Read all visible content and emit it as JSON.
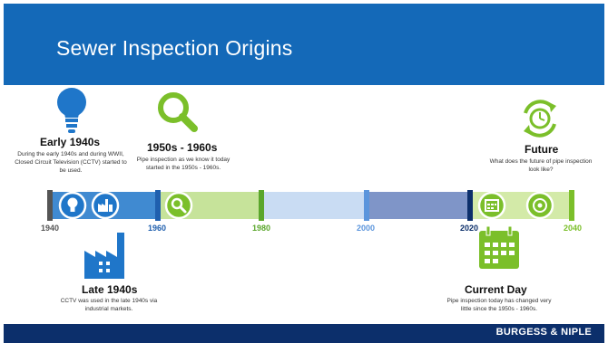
{
  "slide": {
    "title": "Sewer Inspection Origins",
    "footer_brand": "BURGESS & NIPLE"
  },
  "timeline": {
    "years": [
      "1940",
      "1960",
      "1980",
      "2000",
      "2020",
      "2040"
    ]
  },
  "milestones": {
    "early_1940s": {
      "title": "Early 1940s",
      "description": "During the early 1940s and during WWII, Closed Circuit Television (CCTV) started to be used."
    },
    "late_1940s": {
      "title": "Late 1940s",
      "description": "CCTV was used in the late 1940s via industrial markets."
    },
    "mid_century": {
      "title": "1950s - 1960s",
      "description": "Pipe inspection as we know it today started in the 1950s - 1960s."
    },
    "current_day": {
      "title": "Current Day",
      "description": "Pipe inspection today has changed very little since the 1950s - 1960s."
    },
    "future": {
      "title": "Future",
      "description": "What does the future of pipe inspection look like?"
    }
  },
  "icons": {
    "early_1940s": "lightbulb-icon",
    "late_1940s": "factory-icon",
    "mid_century": "magnifier-icon",
    "current_day": "calendar-icon",
    "future": "clock-cycle-icon"
  },
  "colors": {
    "header_blue": "#1469b8",
    "footer_navy": "#0c2f6b",
    "blue_accent": "#1f76c9",
    "green_accent": "#7bbf2a"
  }
}
